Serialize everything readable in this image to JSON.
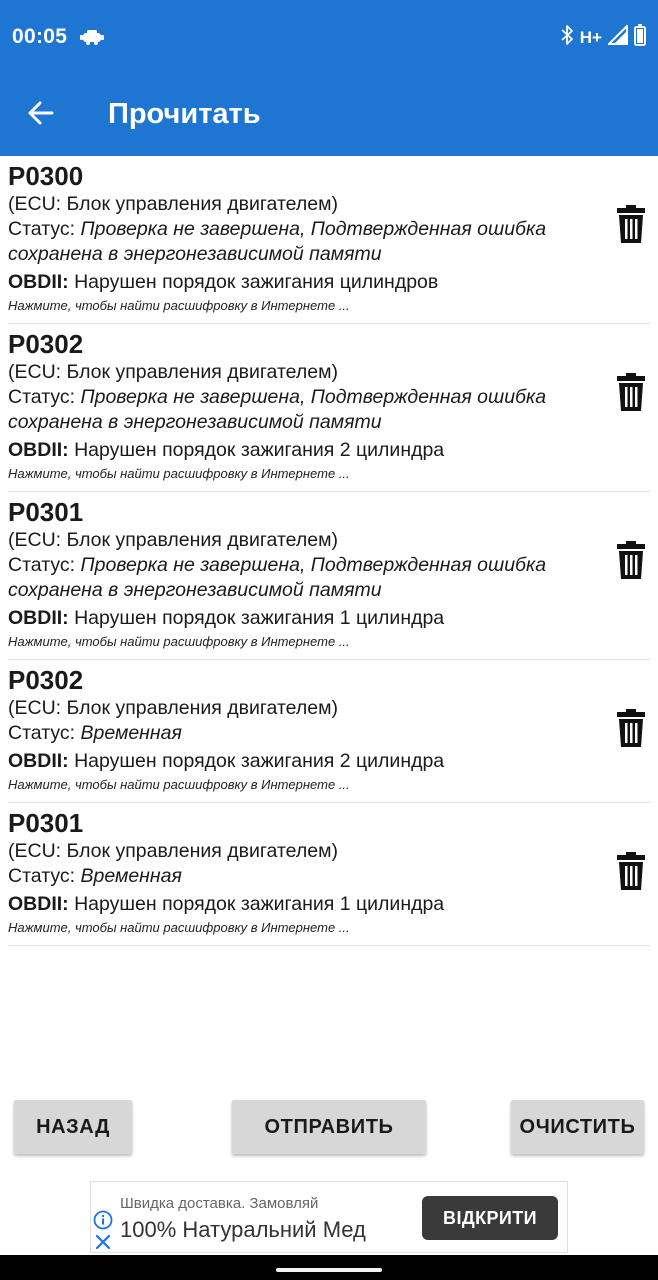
{
  "status_bar": {
    "time": "00:05",
    "network": "H+",
    "icons": [
      "car-icon",
      "bluetooth-icon",
      "signal-icon",
      "battery-icon"
    ]
  },
  "toolbar": {
    "title": "Прочитать"
  },
  "dtc_items": [
    {
      "code": "P0300",
      "ecu": "(ECU: Блок управления двигателем)",
      "status_label": "Статус: ",
      "status_value": "Проверка не завершена, Подтвержденная ошибка сохранена в энергонезависимой памяти",
      "obd_label": "OBDII:",
      "obd_text": " Нарушен порядок зажигания цилиндров",
      "hint": "Нажмите, чтобы найти расшифровку в Интернете ..."
    },
    {
      "code": "P0302",
      "ecu": "(ECU: Блок управления двигателем)",
      "status_label": "Статус: ",
      "status_value": "Проверка не завершена, Подтвержденная ошибка сохранена в энергонезависимой памяти",
      "obd_label": "OBDII:",
      "obd_text": " Нарушен порядок зажигания 2 цилиндра",
      "hint": "Нажмите, чтобы найти расшифровку в Интернете ..."
    },
    {
      "code": "P0301",
      "ecu": "(ECU: Блок управления двигателем)",
      "status_label": "Статус: ",
      "status_value": "Проверка не завершена, Подтвержденная ошибка сохранена в энергонезависимой памяти",
      "obd_label": "OBDII:",
      "obd_text": " Нарушен порядок зажигания 1 цилиндра",
      "hint": "Нажмите, чтобы найти расшифровку в Интернете ..."
    },
    {
      "code": "P0302",
      "ecu": "(ECU: Блок управления двигателем)",
      "status_label": "Статус: ",
      "status_value": "Временная",
      "obd_label": "OBDII:",
      "obd_text": " Нарушен порядок зажигания 2 цилиндра",
      "hint": "Нажмите, чтобы найти расшифровку в Интернете ..."
    },
    {
      "code": "P0301",
      "ecu": "(ECU: Блок управления двигателем)",
      "status_label": "Статус: ",
      "status_value": "Временная",
      "obd_label": "OBDII:",
      "obd_text": " Нарушен порядок зажигания 1 цилиндра",
      "hint": "Нажмите, чтобы найти расшифровку в Интернете ..."
    }
  ],
  "buttons": {
    "back": "НАЗАД",
    "send": "ОТПРАВИТЬ",
    "clear": "ОЧИСТИТЬ"
  },
  "ad": {
    "line1": "Швидка доставка. Замовляй",
    "line2": "100% Натуральний Мед",
    "cta": "ВІДКРИТИ"
  },
  "colors": {
    "app_bar": "#1e76d2",
    "button_bg": "#d7d7d7",
    "ad_cta_bg": "#3a3a3a",
    "ad_icon": "#1a73e8"
  }
}
